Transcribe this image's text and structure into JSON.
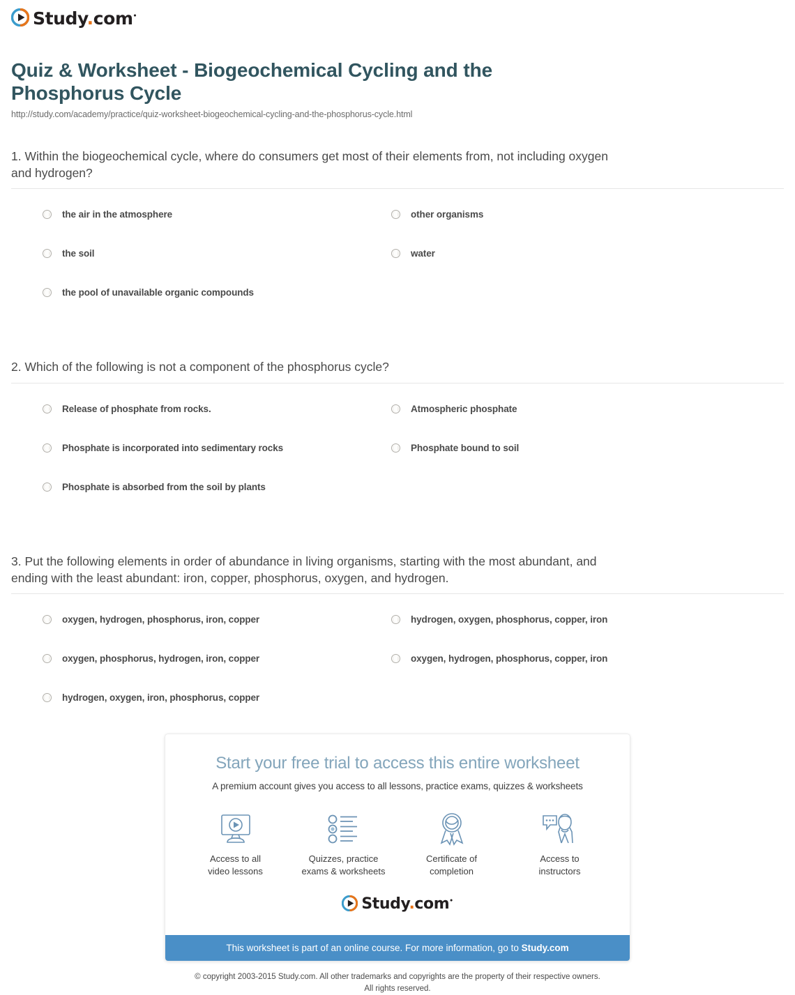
{
  "brand": {
    "name_prefix": "Study",
    "name_dot": ".",
    "name_suffix": "com",
    "trademark": "™",
    "mark_icon": "play-circle-icon",
    "color_blue": "#3b9ccc",
    "color_orange": "#e8751a"
  },
  "header": {
    "title": "Quiz & Worksheet - Biogeochemical Cycling and the Phosphorus Cycle",
    "url": "http://study.com/academy/practice/quiz-worksheet-biogeochemical-cycling-and-the-phosphorus-cycle.html",
    "title_color": "#31555f"
  },
  "questions": [
    {
      "text": "1. Within the biogeochemical cycle, where do consumers get most of their elements from, not including oxygen and hydrogen?",
      "options": [
        "the air in the atmosphere",
        "the soil",
        "the pool of unavailable organic compounds",
        "other organisms",
        "water",
        ""
      ]
    },
    {
      "text": "2. Which of the following is not a component of the phosphorus cycle?",
      "options": [
        "Release of phosphate from rocks.",
        "Phosphate is incorporated into sedimentary rocks",
        "Phosphate is absorbed from the soil by plants",
        "Atmospheric phosphate",
        "Phosphate bound to soil",
        ""
      ]
    },
    {
      "text": "3. Put the following elements in order of abundance in living organisms, starting with the most abundant, and ending with the least abundant: iron, copper, phosphorus, oxygen, and hydrogen.",
      "options": [
        "oxygen, hydrogen, phosphorus, iron, copper",
        "oxygen, phosphorus, hydrogen, iron, copper",
        "hydrogen, oxygen, iron, phosphorus, copper",
        "hydrogen, oxygen, phosphorus, copper, iron",
        "oxygen, hydrogen, phosphorus, copper, iron",
        ""
      ]
    }
  ],
  "promo": {
    "title": "Start your free trial to access this entire worksheet",
    "subtitle": "A premium account gives you access to all lessons, practice exams, quizzes & worksheets",
    "features": [
      {
        "icon": "monitor-play-icon",
        "label": "Access to all\nvideo lessons"
      },
      {
        "icon": "checklist-icon",
        "label": "Quizzes, practice\nexams & worksheets"
      },
      {
        "icon": "award-ribbon-icon",
        "label": "Certificate of\ncompletion"
      },
      {
        "icon": "instructor-chat-icon",
        "label": "Access to\ninstructors"
      }
    ],
    "bar_text_prefix": "This worksheet is part of an online course. For more information, go to ",
    "bar_text_link": "Study.com",
    "bar_color": "#4a8fc7"
  },
  "footer": {
    "copyright_line1": "© copyright 2003-2015 Study.com. All other trademarks and copyrights are the property of their respective owners.",
    "copyright_line2": "All rights reserved."
  }
}
